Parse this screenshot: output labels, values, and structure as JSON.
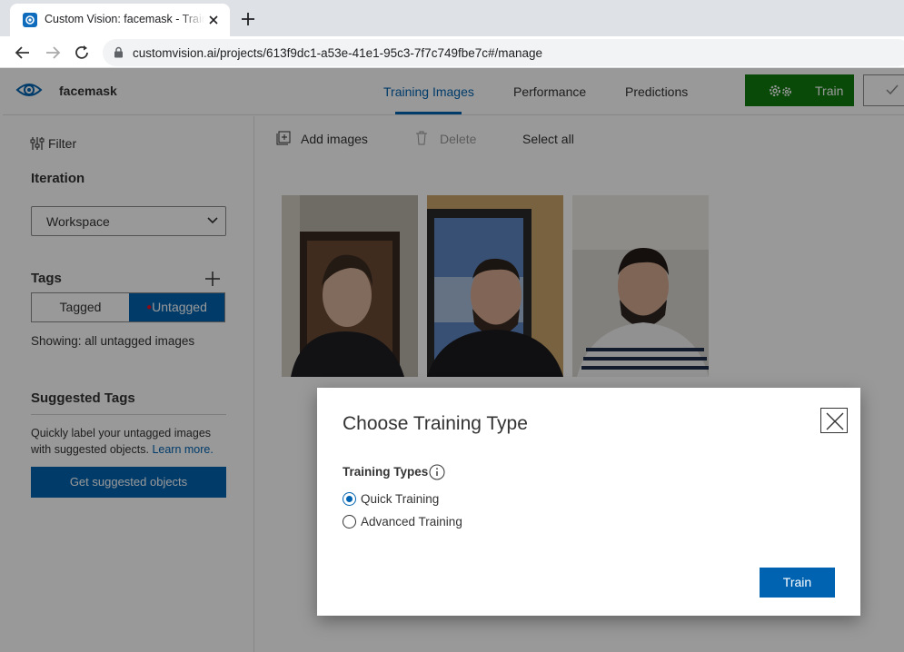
{
  "browser": {
    "tab_title": "Custom Vision: facemask - Training Images",
    "url": "customvision.ai/projects/613f9dc1-a53e-41e1-95c3-7f7c749fbe7c#/manage"
  },
  "app": {
    "project_name": "facemask",
    "nav_tabs": [
      {
        "label": "Training Images",
        "active": true
      },
      {
        "label": "Performance",
        "active": false
      },
      {
        "label": "Predictions",
        "active": false
      }
    ],
    "train_button": "Train"
  },
  "sidebar": {
    "filter_label": "Filter",
    "iteration_title": "Iteration",
    "iteration_value": "Workspace",
    "tags_title": "Tags",
    "tagged_label": "Tagged",
    "untagged_label": "Untagged",
    "showing_text": "Showing: all untagged images",
    "suggested_title": "Suggested Tags",
    "suggested_desc": "Quickly label your untagged images with suggested objects.",
    "learn_more": "Learn more.",
    "suggest_button": "Get suggested objects"
  },
  "toolbar": {
    "add_images": "Add images",
    "delete": "Delete",
    "select_all": "Select all"
  },
  "dialog": {
    "title": "Choose Training Type",
    "types_label": "Training Types",
    "options": [
      {
        "label": "Quick Training",
        "checked": true
      },
      {
        "label": "Advanced Training",
        "checked": false
      }
    ],
    "train_button": "Train"
  },
  "colors": {
    "accent": "#0063b1",
    "train_green": "#107c10"
  }
}
